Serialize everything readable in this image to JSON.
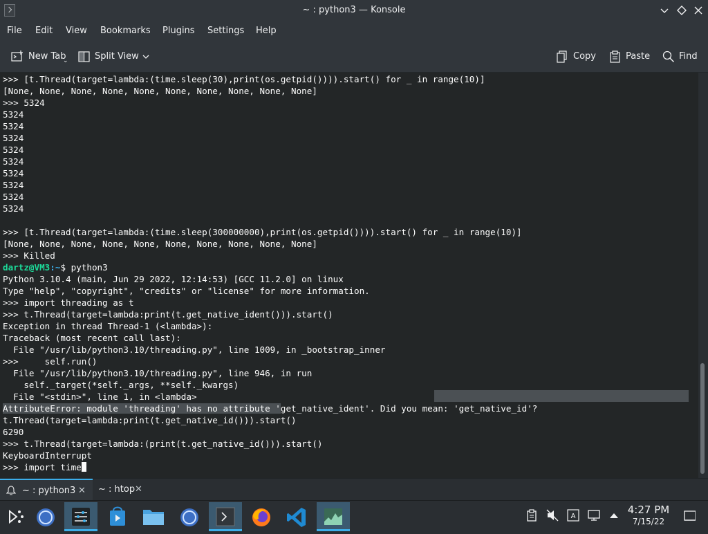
{
  "window": {
    "title": "~ : python3 — Konsole",
    "buttons": [
      "minimize",
      "maximize",
      "close"
    ]
  },
  "menu": [
    "File",
    "Edit",
    "View",
    "Bookmarks",
    "Plugins",
    "Settings",
    "Help"
  ],
  "toolbar": {
    "new_tab": "New Tab",
    "split_view": "Split View",
    "copy": "Copy",
    "paste": "Paste",
    "find": "Find"
  },
  "terminal": {
    "lines": [
      ">>> [t.Thread(target=lambda:(time.sleep(30),print(os.getpid()))).start() for _ in range(10)]",
      "[None, None, None, None, None, None, None, None, None, None]",
      ">>> 5324",
      "5324",
      "5324",
      "5324",
      "5324",
      "5324",
      "5324",
      "5324",
      "5324",
      "5324",
      "",
      ">>> [t.Thread(target=lambda:(time.sleep(300000000),print(os.getpid()))).start() for _ in range(10)]",
      "[None, None, None, None, None, None, None, None, None, None]",
      ">>> Killed",
      "",
      "Python 3.10.4 (main, Jun 29 2022, 12:14:53) [GCC 11.2.0] on linux",
      "Type \"help\", \"copyright\", \"credits\" or \"license\" for more information.",
      ">>> import threading as t",
      ">>> t.Thread(target=lambda:print(t.get_native_ident())).start()",
      "Exception in thread Thread-1 (<lambda>):",
      "Traceback (most recent call last):",
      "  File \"/usr/lib/python3.10/threading.py\", line 1009, in _bootstrap_inner",
      ">>>     self.run()",
      "  File \"/usr/lib/python3.10/threading.py\", line 946, in run",
      "    self._target(*self._args, **self._kwargs)",
      "  File \"<stdin>\", line 1, in <lambda>",
      "",
      "t.Thread(target=lambda:print(t.get_native_id())).start()",
      "6290",
      ">>> t.Thread(target=lambda:(print(t.get_native_id())).start()",
      "KeyboardInterrupt",
      ">>> import time"
    ],
    "prompt": {
      "user": "dartz@VM3",
      "sep": ":",
      "path": "~",
      "symbol": "$",
      "command": " python3"
    },
    "error_line": {
      "selected_part": "AttributeError: module 'threading' has no attribute '",
      "rest": "get_native_ident'. Did you mean: 'get_native_id'?"
    }
  },
  "tabs": [
    {
      "label": "~ : python3",
      "active": true
    },
    {
      "label": "~ : htop",
      "active": false
    }
  ],
  "taskbar": {
    "apps": [
      "app-launcher",
      "overview",
      "system-settings",
      "discover",
      "file-manager",
      "browser",
      "konsole",
      "firefox",
      "vscode",
      "system-monitor"
    ],
    "tray": [
      "clipboard-icon",
      "volume-muted-icon",
      "keyboard-layout-icon",
      "network-icon",
      "expand-tray-icon"
    ],
    "time": "4:27 PM",
    "date": "7/15/22"
  },
  "colors": {
    "terminal_bg": "#232627",
    "user_prompt": "#1cdc9a",
    "path_prompt": "#3daee9",
    "accent": "#3daee9"
  }
}
